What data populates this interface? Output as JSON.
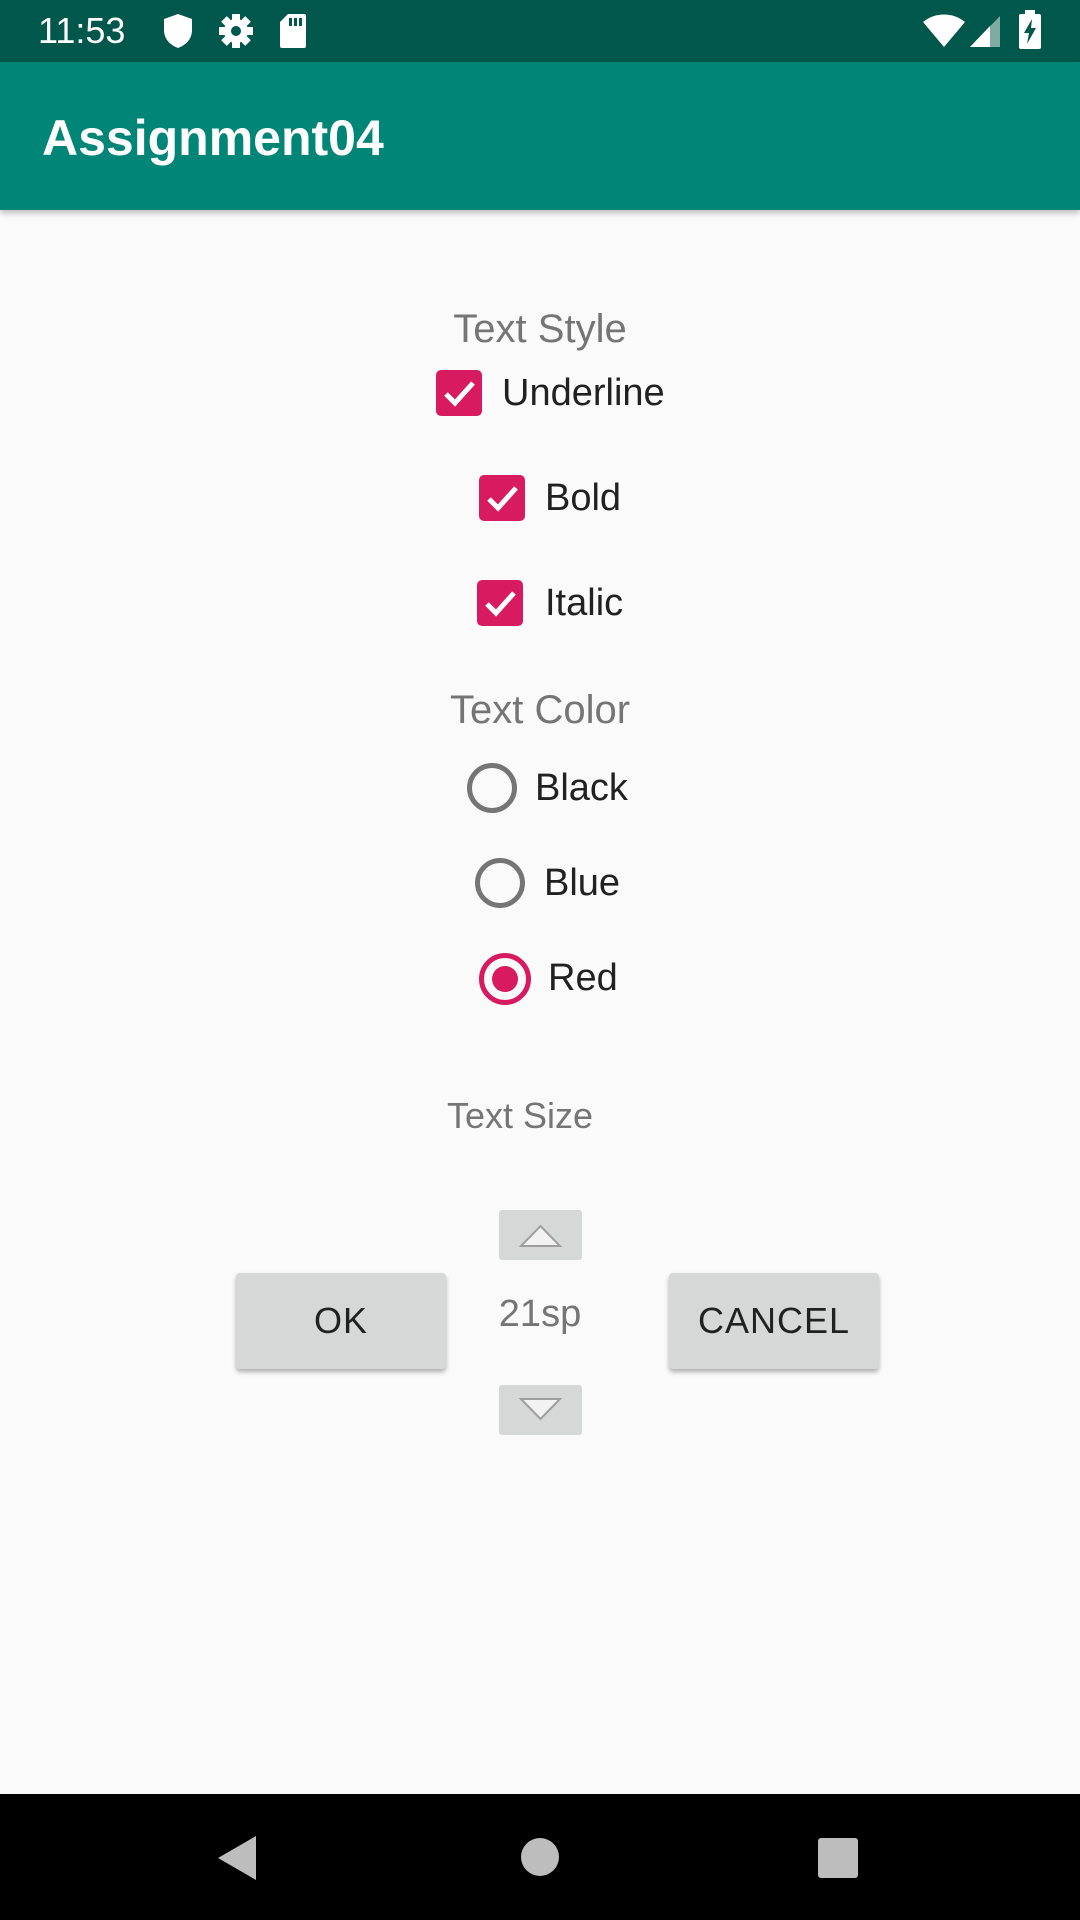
{
  "status_bar": {
    "time": "11:53",
    "left_icons": [
      "shield-icon",
      "gear-icon",
      "sd-card-icon"
    ],
    "right_icons": [
      "wifi-icon",
      "signal-icon",
      "battery-charging-icon"
    ]
  },
  "app_bar": {
    "title": "Assignment04",
    "color": "#008577"
  },
  "text_style": {
    "title": "Text Style",
    "options": [
      {
        "label": "Underline",
        "checked": true
      },
      {
        "label": "Bold",
        "checked": true
      },
      {
        "label": "Italic",
        "checked": true
      }
    ]
  },
  "text_color": {
    "title": "Text Color",
    "options": [
      {
        "label": "Black",
        "selected": false
      },
      {
        "label": "Blue",
        "selected": false
      },
      {
        "label": "Red",
        "selected": true
      }
    ]
  },
  "text_size": {
    "title": "Text Size",
    "value": "21sp"
  },
  "buttons": {
    "ok": "OK",
    "cancel": "CANCEL"
  },
  "nav_bar": {
    "icons": [
      "back-icon",
      "home-icon",
      "recents-icon"
    ]
  },
  "colors": {
    "accent": "#d81b60",
    "primary": "#008577",
    "primary_dark": "#00574b"
  }
}
